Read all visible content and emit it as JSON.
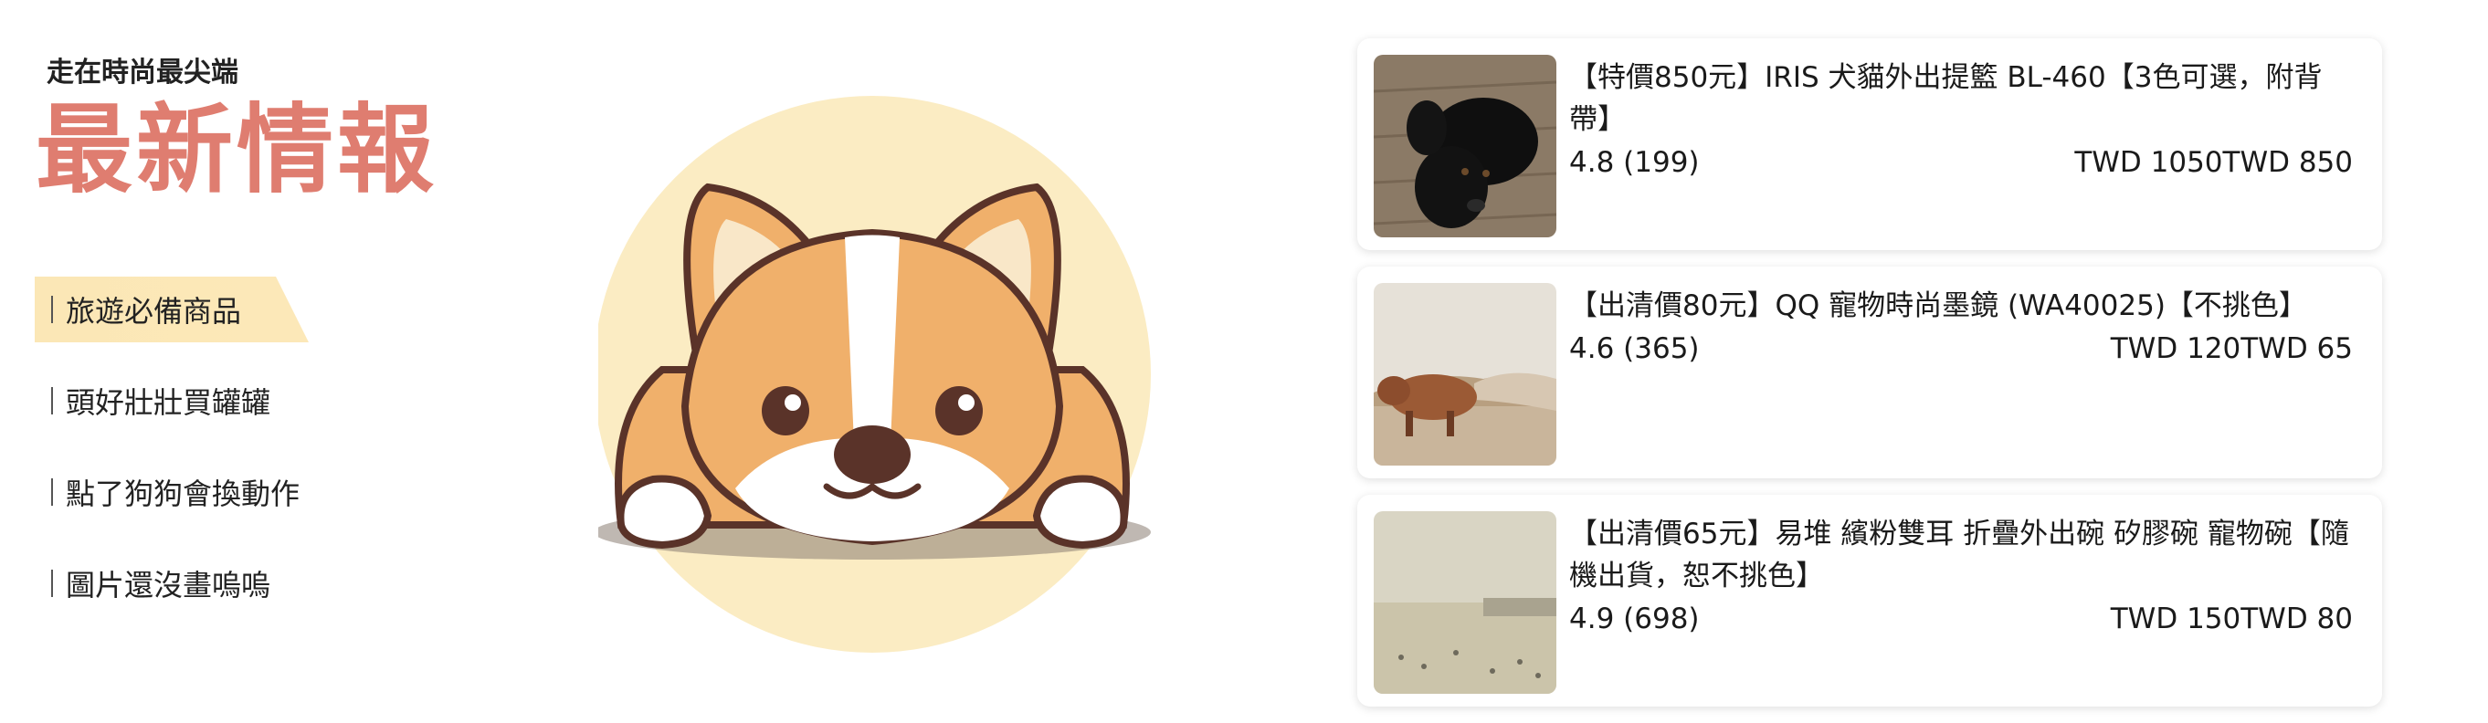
{
  "header": {
    "tagline": "走在時尚最尖端",
    "title": "最新情報"
  },
  "nav": {
    "items": [
      {
        "label": "旅遊必備商品"
      },
      {
        "label": "頭好壯壯買罐罐"
      },
      {
        "label": "點了狗狗會換動作"
      },
      {
        "label": "圖片還沒畫嗚嗚"
      }
    ]
  },
  "products": [
    {
      "name": "【特價850元】IRIS 犬貓外出提籃 BL-460【3色可選，附背帶】",
      "rating": "4.8 (199)",
      "price": "TWD 1050TWD 850",
      "image": "black-dog-photo"
    },
    {
      "name": "【出清價80元】QQ 寵物時尚墨鏡 (WA40025)【不挑色】",
      "rating": "4.6 (365)",
      "price": "TWD 120TWD 65",
      "image": "highland-cow-photo"
    },
    {
      "name": "【出清價65元】易堆 繽粉雙耳 折疊外出碗 矽膠碗 寵物碗【隨機出貨，恕不挑色】",
      "rating": "4.9 (698)",
      "price": "TWD 150TWD 80",
      "image": "beach-photo"
    }
  ],
  "colors": {
    "accent": "#df7d70",
    "highlight": "#fbe7b6",
    "dog_orange": "#f0b06b"
  }
}
